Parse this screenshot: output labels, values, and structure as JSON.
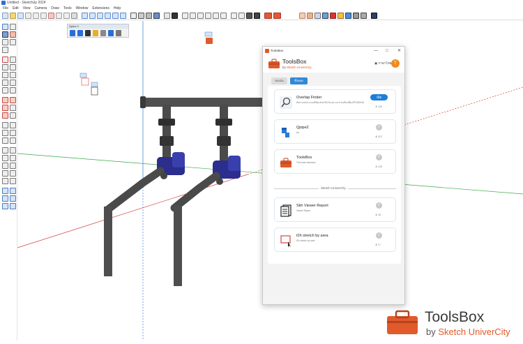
{
  "window": {
    "title": "Untitled - SketchUp 2024"
  },
  "menu": [
    "File",
    "Edit",
    "View",
    "Camera",
    "Draw",
    "Tools",
    "Window",
    "Extensions",
    "Help"
  ],
  "floating_toolbar": {
    "title": "Qpipe 2"
  },
  "toolsbox_window": {
    "title": "ToolsBox",
    "controls": [
      "—",
      "□",
      "✕"
    ],
    "app_name": "ToolsBox",
    "byline_prefix": "by",
    "byline_brand": "Sketch UniverCity",
    "lang_label": "ภาษาไทย",
    "avatar_initial": "T",
    "tabs": [
      {
        "label": "ของฉัน",
        "active": false
      },
      {
        "label": "ทั้งหมด",
        "active": true
      }
    ],
    "cards": [
      {
        "name": "Overlap Finder",
        "desc": "ค้นหาองค์ประกอบที่ซ้อนทับกันในโมเดล และช่วยเลือกเพื่อแก้ไขได้ทันที",
        "action": "เปิด",
        "downloads": "133",
        "installed": false,
        "icon": "magnifier-icon"
      },
      {
        "name": "Qpipe2",
        "desc": "ท่อ",
        "downloads": "212",
        "installed": true,
        "icon": "pipe-icon"
      },
      {
        "name": "ToolsBox",
        "desc": "The main extension",
        "downloads": "125",
        "installed": true,
        "icon": "toolbox-icon"
      },
      {
        "name": "Skh Viewer Report",
        "desc": "Viewer Report",
        "downloads": "18",
        "installed": true,
        "icon": "report-icon"
      },
      {
        "name": "t2h stretch by area",
        "desc": "t2h stretch by area",
        "downloads": "17",
        "installed": true,
        "icon": "stretch-icon"
      }
    ],
    "section_label": "Sketch UniverCity"
  },
  "brand": {
    "name": "ToolsBox",
    "byline_prefix": "by",
    "byline_brand": "Sketch UniverCity"
  },
  "colors": {
    "accent": "#e05a2b",
    "blue": "#1e7ed8",
    "pipe": "#555555",
    "motor": "#2b2e8c"
  }
}
